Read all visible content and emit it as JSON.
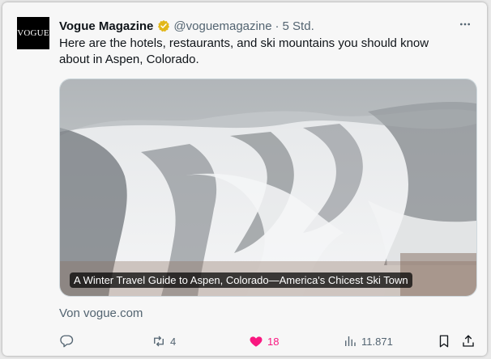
{
  "post": {
    "avatar_text": "VOGUE",
    "author_name": "Vogue Magazine",
    "handle": "@voguemagazine",
    "separator": "·",
    "time": "5 Std.",
    "text": "Here are the hotels, restaurants, and ski mountains you should know about in Aspen, Colorado.",
    "link_card": {
      "caption": "A Winter Travel Guide to Aspen, Colorado—America's Chicest Ski Town",
      "source": "Von vogue.com"
    },
    "actions": {
      "reply_count": "",
      "repost_count": "4",
      "like_count": "18",
      "views_count": "11.871"
    }
  },
  "icons": {
    "verified": "verified-badge-icon",
    "more": "more-options-icon",
    "reply": "reply-icon",
    "repost": "repost-icon",
    "like": "heart-icon",
    "views": "views-chart-icon",
    "bookmark": "bookmark-icon",
    "share": "share-icon"
  },
  "colors": {
    "like_active": "#f91880",
    "verified_gold": "#e2b719",
    "muted_text": "#536471"
  }
}
